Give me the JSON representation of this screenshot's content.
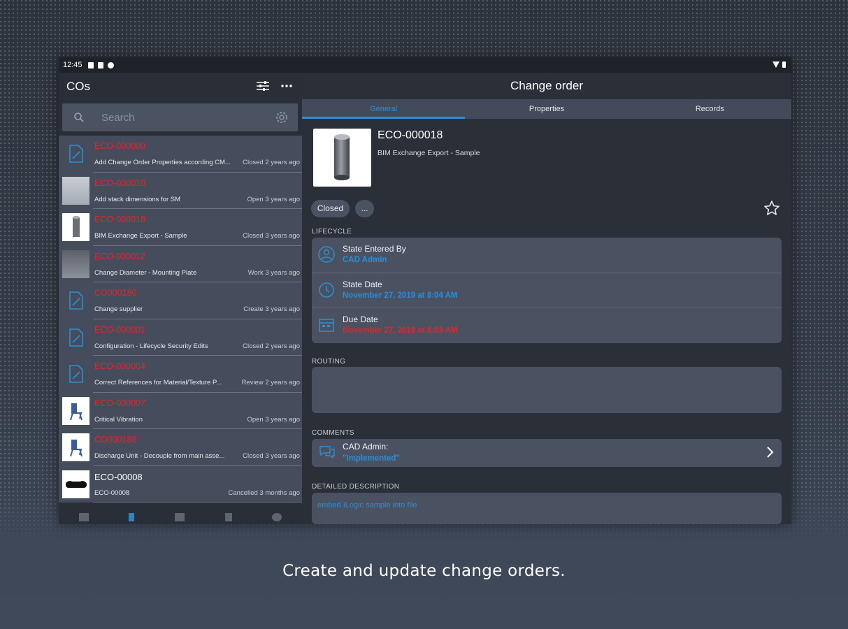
{
  "caption": "Create and update change orders.",
  "status_bar": {
    "time": "12:45"
  },
  "left_pane": {
    "title": "COs",
    "search": {
      "placeholder": "Search"
    },
    "items": [
      {
        "number": "ECO-000000",
        "description": "Add Change Order Properties according CM...",
        "status": "Closed 2 years ago",
        "thumb": "doc-icon"
      },
      {
        "number": "ECO-000010",
        "description": "Add stack dimensions for SM",
        "status": "Open 3 years ago",
        "thumb": "gray"
      },
      {
        "number": "ECO-000018",
        "description": "BIM Exchange Export - Sample",
        "status": "Closed 3 years ago",
        "thumb": "cylinder"
      },
      {
        "number": "ECO-000012",
        "description": "Change Diameter - Mounting Plate",
        "status": "Work 3 years ago",
        "thumb": "dark"
      },
      {
        "number": "CO000180",
        "description": "Change supplier",
        "status": "Create 3 years ago",
        "thumb": "doc-icon"
      },
      {
        "number": "ECO-000001",
        "description": "Configuration - Lifecycle Security Edits",
        "status": "Closed 2 years ago",
        "thumb": "doc-icon"
      },
      {
        "number": "ECO-000004",
        "description": "Correct References for Material/Texture P...",
        "status": "Review 2 years ago",
        "thumb": "doc-icon"
      },
      {
        "number": "ECO-000007",
        "description": "Critical Vibration",
        "status": "Open 3 years ago",
        "thumb": "chair"
      },
      {
        "number": "CO000186",
        "description": "Discharge Unit - Decouple from main asse...",
        "status": "Closed 3 years ago",
        "thumb": "chair"
      },
      {
        "number": "ECO-00008",
        "description": "ECO-00008",
        "status": "Cancelled 3 months ago",
        "thumb": "shaft"
      }
    ]
  },
  "right_pane": {
    "title": "Change order",
    "tabs": [
      {
        "label": "General"
      },
      {
        "label": "Properties"
      },
      {
        "label": "Records"
      }
    ],
    "number": "ECO-000018",
    "name": "BIM Exchange Export - Sample",
    "state": "Closed",
    "more_button": "...",
    "lifecycle_label": "LIFECYCLE",
    "lifecycle": [
      {
        "label": "State Entered By",
        "value": "CAD Admin"
      },
      {
        "label": "State Date",
        "value": "November 27, 2019 at 8:04 AM"
      },
      {
        "label": "Due Date",
        "value": "November 27, 2019 at 8:03 AM"
      }
    ],
    "routing_label": "ROUTING",
    "comments_label": "COMMENTS",
    "comment": {
      "author": "CAD Admin:",
      "text": "\"Implemented\""
    },
    "description_label": "DETAILED DESCRIPTION",
    "description": "embed ILogic sample into file"
  },
  "colors": {
    "accent": "#2e8fd0",
    "overdue_red": "#e0262d",
    "card": "#4a5262",
    "list_item": "#454d5c"
  }
}
